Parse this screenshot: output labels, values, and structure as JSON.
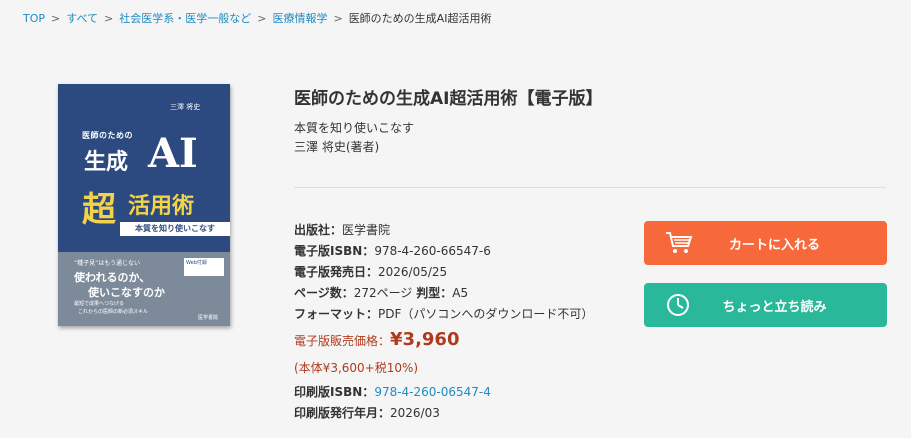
{
  "breadcrumb": {
    "items": [
      "TOP",
      "すべて",
      "社会医学系・医学一般など",
      "医療情報学"
    ],
    "current": "医師のための生成AI超活用術",
    "separator": ">"
  },
  "cover": {
    "author": "三澤 将史",
    "small": "医師のための",
    "line1": "生成",
    "ai": "AI",
    "cho": "超",
    "katsuyou": "活用術",
    "band": "本質を知り使いこなす",
    "quote": "“種子見”はもう通じない",
    "b1": "使われるのか、",
    "b2": "使いこなすのか",
    "b3": "最短で成果へつなげる",
    "b4": "これからの医師の新必須スキル",
    "web": "Web付録",
    "publisher": "医学書院"
  },
  "book": {
    "title": "医師のための生成AI超活用術【電子版】",
    "subtitle": "本質を知り使いこなす",
    "authors": "三澤 将史(著者)"
  },
  "details": {
    "publisher_label": "出版社：",
    "publisher": "医学書院",
    "isbn_label": "電子版ISBN：",
    "isbn": "978-4-260-66547-6",
    "release_label": "電子版発売日：",
    "release": "2026/05/25",
    "pages_label": "ページ数：",
    "pages": "272ページ",
    "size_label": "判型：",
    "size": "A5",
    "format_label": "フォーマット：",
    "format": "PDF（パソコンへのダウンロード不可）",
    "price_label": "電子版販売価格：",
    "price": "¥3,960",
    "tax": "(本体¥3,600+税10%)",
    "print_isbn_label": "印刷版ISBN：",
    "print_isbn": "978-4-260-06547-4",
    "print_date_label": "印刷版発行年月：",
    "print_date": "2026/03"
  },
  "buttons": {
    "cart": "カートに入れる",
    "preview": "ちょっと立ち読み"
  },
  "colors": {
    "cart": "#f7693a",
    "preview": "#2ab89a",
    "price": "#b03a1e",
    "link": "#1e8bc3"
  }
}
